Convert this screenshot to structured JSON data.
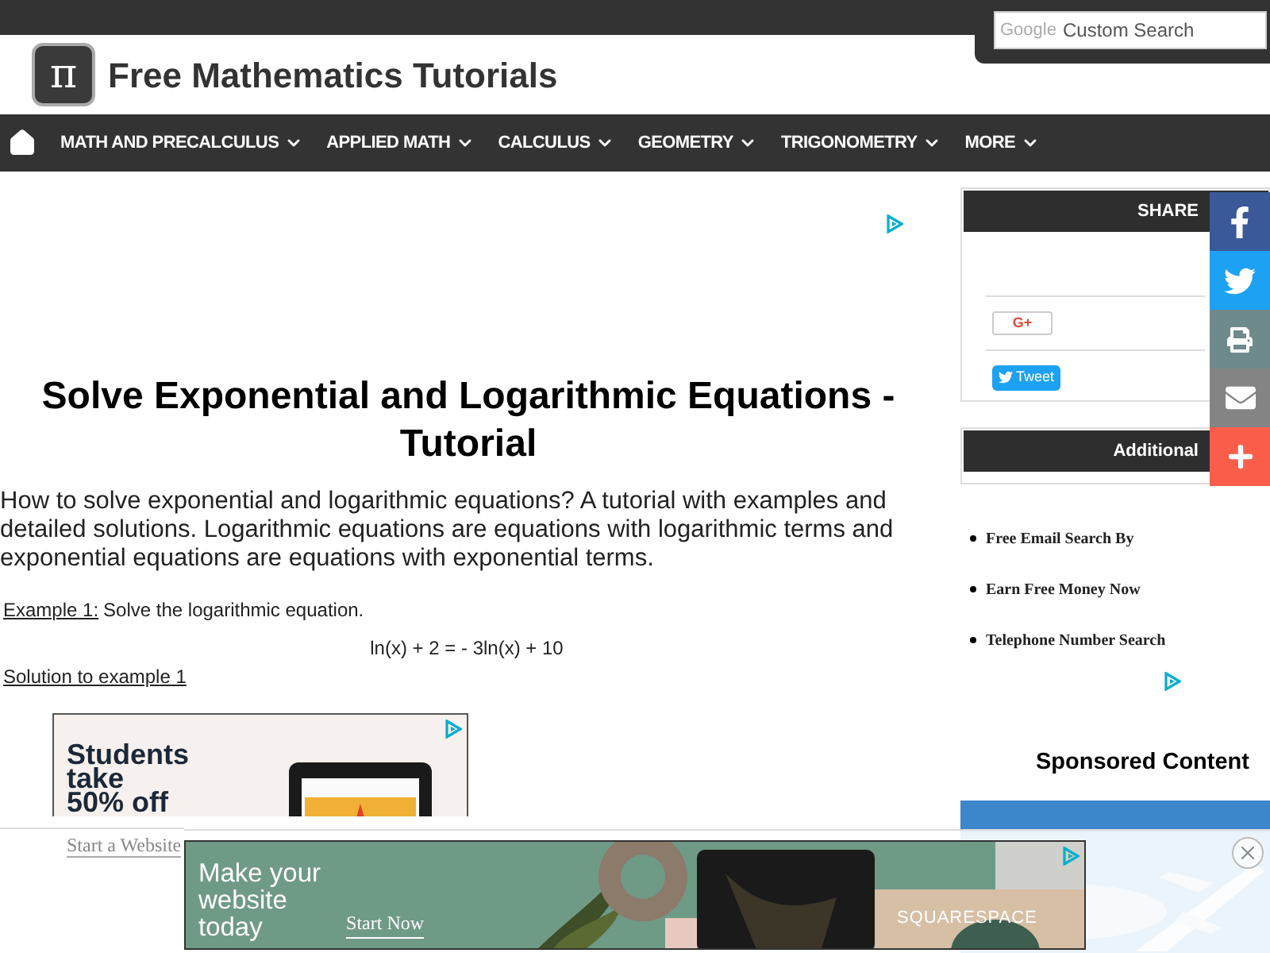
{
  "search": {
    "brand": "Google",
    "placeholder": "Custom Search"
  },
  "site": {
    "logo": "π",
    "title": "Free Mathematics Tutorials"
  },
  "nav": [
    {
      "label": "MATH AND PRECALCULUS"
    },
    {
      "label": "APPLIED MATH"
    },
    {
      "label": "CALCULUS"
    },
    {
      "label": "GEOMETRY"
    },
    {
      "label": "TRIGONOMETRY"
    },
    {
      "label": "MORE"
    }
  ],
  "article": {
    "title": "Solve Exponential and Logarithmic Equations - Tutorial",
    "intro": "How to solve exponential and logarithmic equations? A tutorial with examples and detailed solutions. Logarithmic equations are equations with logarithmic terms and exponential equations are equations with exponential terms.",
    "example_label": "Example 1:",
    "example_text": "Solve the logarithmic equation.",
    "equation": "ln(x) + 2 = - 3ln(x) + 10",
    "solution_link": "Solution to example 1"
  },
  "inline_ad": {
    "headline": [
      "Students",
      "take",
      "50% off"
    ],
    "cta": "Start a Website"
  },
  "sidebar": {
    "share": {
      "title": "SHARE",
      "buttons": [
        {
          "kind": "gplus",
          "label": "G+"
        },
        {
          "kind": "tweet",
          "label": "Tweet"
        }
      ]
    },
    "additional": {
      "title": "Additional",
      "links": [
        "Free Email Search By",
        "Earn Free Money Now",
        "Telephone Number Search"
      ]
    },
    "sponsored_title": "Sponsored Content"
  },
  "social_buttons": [
    {
      "kind": "facebook",
      "color": "#3b5998"
    },
    {
      "kind": "twitter",
      "color": "#1da1f2"
    },
    {
      "kind": "print",
      "color": "#6f8a8a"
    },
    {
      "kind": "email",
      "color": "#848484"
    },
    {
      "kind": "more",
      "color": "#fa5e4b"
    }
  ],
  "bottom_ad": {
    "headline": [
      "Make your",
      "website",
      "today"
    ],
    "cta": "Start Now",
    "brand": "SQUARESPACE"
  }
}
